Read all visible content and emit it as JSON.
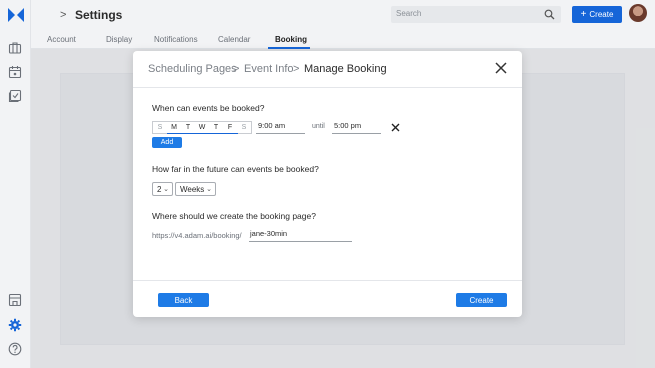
{
  "app": {
    "page_title": "Settings",
    "breadcrumb_chevron": ">"
  },
  "search": {
    "placeholder": "Search"
  },
  "header": {
    "create_label": "Create",
    "create_plus": "+"
  },
  "tabs": [
    {
      "label": "Account"
    },
    {
      "label": "Display"
    },
    {
      "label": "Notifications"
    },
    {
      "label": "Calendar"
    },
    {
      "label": "Booking",
      "active": true
    }
  ],
  "modal": {
    "breadcrumbs": [
      "Scheduling Pages",
      "Event Info",
      "Manage Booking"
    ],
    "breadcrumb_sep": ">",
    "q_when": "When can events be booked?",
    "days": [
      {
        "label": "S",
        "enabled": false
      },
      {
        "label": "M",
        "enabled": true
      },
      {
        "label": "T",
        "enabled": true
      },
      {
        "label": "W",
        "enabled": true
      },
      {
        "label": "T",
        "enabled": true
      },
      {
        "label": "F",
        "enabled": true
      },
      {
        "label": "S",
        "enabled": false
      }
    ],
    "start_time": "9:00 am",
    "until_label": "until",
    "end_time": "5:00 pm",
    "add_label": "Add",
    "q_future": "How far in the future can events be booked?",
    "future_amount": "2",
    "future_unit": "Weeks",
    "q_where": "Where should we create the booking page?",
    "url_prefix": "https://v4.adam.ai/booking/",
    "url_slug": "jane-30min",
    "back_label": "Back",
    "create_label": "Create"
  },
  "colors": {
    "accent": "#1565d8",
    "button": "#1e7be6",
    "sidebar_active_icon": "#1565d8"
  }
}
